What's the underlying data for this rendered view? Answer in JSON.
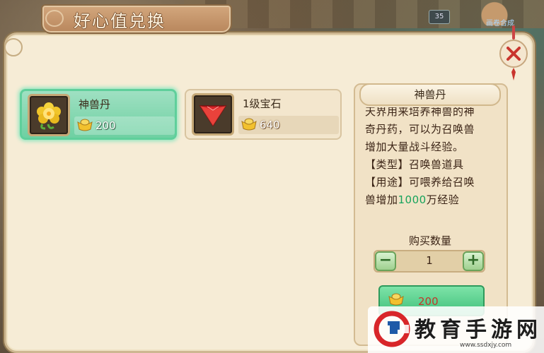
{
  "window": {
    "title": "好心值兑换"
  },
  "background": {
    "counter": "35",
    "right_label": "画卷合成"
  },
  "items": [
    {
      "name": "神兽丹",
      "price": "200",
      "currency": "好心",
      "icon": "golden-flower-icon",
      "selected": true
    },
    {
      "name": "1级宝石",
      "price": "640",
      "currency": "好心",
      "icon": "red-gem-icon",
      "selected": false
    }
  ],
  "detail": {
    "title": "神兽丹",
    "description_lines": [
      "天界用来培养神兽的神",
      "奇丹药，可以为召唤兽",
      "增加大量战斗经验。",
      "【类型】召唤兽道具",
      "【用途】可喂养给召唤"
    ],
    "last_line_prefix": "兽增加",
    "last_line_highlight": "1000",
    "last_line_suffix": "万经验",
    "buy_quantity_label": "购买数量",
    "quantity": "1",
    "minus_label": "−",
    "plus_label": "+",
    "buy_price": "200"
  },
  "watermark": {
    "text": "教育手游网",
    "url": "www.ssdxjy.com"
  },
  "colors": {
    "selected_card": "#6ed0a2",
    "panel_bg": "#f6ecd6",
    "highlight_green": "#17a35c",
    "price_red": "#c0392b"
  }
}
